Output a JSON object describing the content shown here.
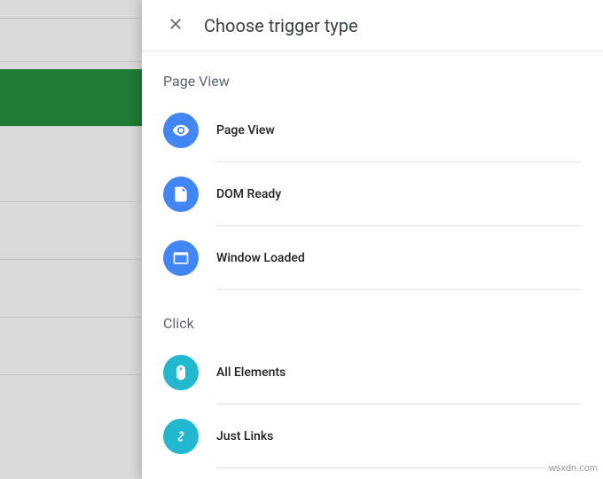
{
  "header": {
    "title": "Choose trigger type"
  },
  "sections": [
    {
      "title": "Page View",
      "items": [
        {
          "label": "Page View",
          "icon": "eye",
          "color": "#4285f4"
        },
        {
          "label": "DOM Ready",
          "icon": "file",
          "color": "#4285f4"
        },
        {
          "label": "Window Loaded",
          "icon": "window",
          "color": "#4285f4"
        }
      ]
    },
    {
      "title": "Click",
      "items": [
        {
          "label": "All Elements",
          "icon": "mouse",
          "color": "#22b8cf"
        },
        {
          "label": "Just Links",
          "icon": "link",
          "color": "#22b8cf"
        }
      ]
    }
  ],
  "watermark": "wsxdn.com"
}
